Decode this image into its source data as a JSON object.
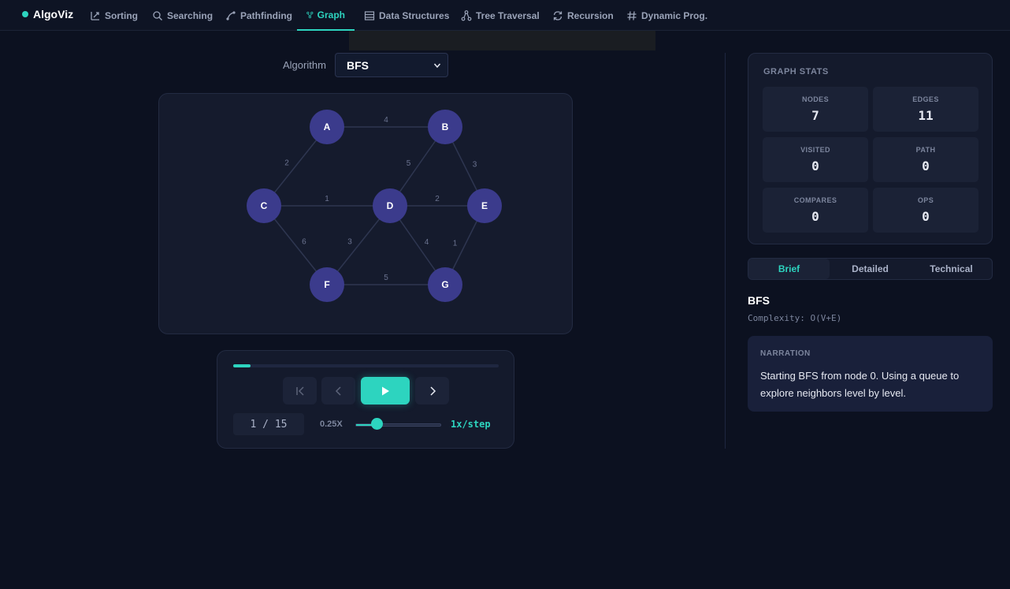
{
  "app": {
    "brand": "AlgoViz"
  },
  "nav": {
    "tabs": [
      {
        "label": "Sorting",
        "icon": "sort-icon",
        "active": false
      },
      {
        "label": "Searching",
        "icon": "search-icon",
        "active": false
      },
      {
        "label": "Pathfinding",
        "icon": "path-icon",
        "active": false
      },
      {
        "label": "Graph",
        "icon": "graph-icon",
        "active": true
      },
      {
        "label": "Data Structures",
        "icon": "list-icon",
        "active": false
      },
      {
        "label": "Tree Traversal",
        "icon": "tree-icon",
        "active": false
      },
      {
        "label": "Recursion",
        "icon": "refresh-icon",
        "active": false
      },
      {
        "label": "Dynamic Prog.",
        "icon": "hash-icon",
        "active": false
      }
    ]
  },
  "algorithm": {
    "label": "Algorithm",
    "selected": "BFS"
  },
  "graph": {
    "nodes": [
      {
        "id": "A"
      },
      {
        "id": "B"
      },
      {
        "id": "C"
      },
      {
        "id": "D"
      },
      {
        "id": "E"
      },
      {
        "id": "F"
      },
      {
        "id": "G"
      }
    ],
    "edges": [
      {
        "from": "A",
        "to": "B",
        "weight": "4"
      },
      {
        "from": "A",
        "to": "C",
        "weight": "2"
      },
      {
        "from": "B",
        "to": "D",
        "weight": "5"
      },
      {
        "from": "B",
        "to": "E",
        "weight": "3"
      },
      {
        "from": "C",
        "to": "D",
        "weight": "1"
      },
      {
        "from": "D",
        "to": "E",
        "weight": "2"
      },
      {
        "from": "C",
        "to": "F",
        "weight": "6"
      },
      {
        "from": "D",
        "to": "F",
        "weight": "3"
      },
      {
        "from": "D",
        "to": "G",
        "weight": "4"
      },
      {
        "from": "E",
        "to": "G",
        "weight": "1"
      },
      {
        "from": "F",
        "to": "G",
        "weight": "5"
      }
    ],
    "colors": {
      "node": "#3b3b8c",
      "edge": "#2e3650",
      "weight": "#6b7390"
    }
  },
  "controls": {
    "progress": 0.0667,
    "step_text": "1 / 15",
    "speed_min": "0.25X",
    "speed_value": 0.25,
    "speed_label": "1x/step"
  },
  "stats": {
    "title": "GRAPH STATS",
    "items": [
      {
        "label": "NODES",
        "value": "7"
      },
      {
        "label": "EDGES",
        "value": "11"
      },
      {
        "label": "VISITED",
        "value": "0"
      },
      {
        "label": "PATH",
        "value": "0"
      },
      {
        "label": "COMPARES",
        "value": "0"
      },
      {
        "label": "OPS",
        "value": "0"
      }
    ]
  },
  "explanation": {
    "tabs": [
      {
        "label": "Brief",
        "active": true
      },
      {
        "label": "Detailed",
        "active": false
      },
      {
        "label": "Technical",
        "active": false
      }
    ],
    "name": "BFS",
    "complexity": "Complexity: O(V+E)",
    "narration_title": "NARRATION",
    "narration": "Starting BFS from node 0. Using a queue to explore neighbors level by level."
  },
  "theme": {
    "accent": "#2dd4bf",
    "bg": "#0c1120",
    "panel": "#141a2c"
  }
}
